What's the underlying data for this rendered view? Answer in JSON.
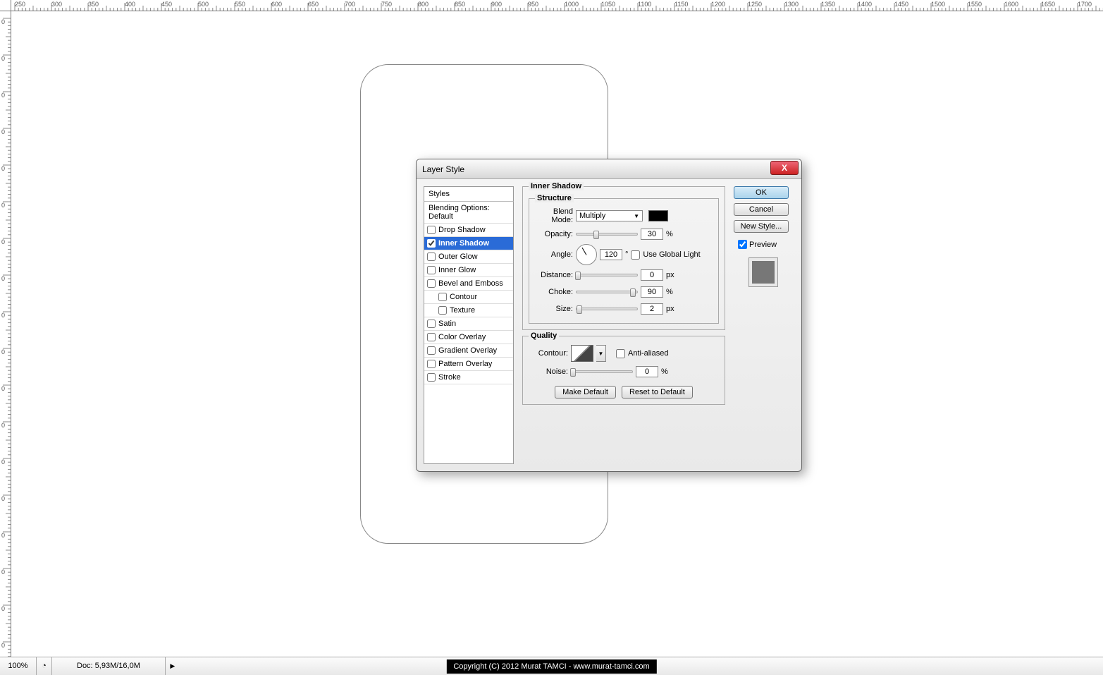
{
  "dialog": {
    "title": "Layer Style",
    "close_label": "X",
    "styles_header": "Styles",
    "styles": {
      "blending": "Blending Options: Default",
      "drop_shadow": "Drop Shadow",
      "inner_shadow": "Inner Shadow",
      "outer_glow": "Outer Glow",
      "inner_glow": "Inner Glow",
      "bevel_emboss": "Bevel and Emboss",
      "contour": "Contour",
      "texture": "Texture",
      "satin": "Satin",
      "color_overlay": "Color Overlay",
      "gradient_overlay": "Gradient Overlay",
      "pattern_overlay": "Pattern Overlay",
      "stroke": "Stroke"
    },
    "panel_title": "Inner Shadow",
    "structure_title": "Structure",
    "quality_title": "Quality",
    "labels": {
      "blend_mode": "Blend Mode:",
      "opacity": "Opacity:",
      "angle": "Angle:",
      "distance": "Distance:",
      "choke": "Choke:",
      "size": "Size:",
      "contour": "Contour:",
      "noise": "Noise:",
      "use_global": "Use Global Light",
      "anti_aliased": "Anti-aliased"
    },
    "values": {
      "blend_mode": "Multiply",
      "opacity": "30",
      "angle": "120",
      "distance": "0",
      "choke": "90",
      "size": "2",
      "noise": "0"
    },
    "units": {
      "percent": "%",
      "degree": "°",
      "px": "px"
    },
    "buttons": {
      "ok": "OK",
      "cancel": "Cancel",
      "new_style": "New Style...",
      "preview": "Preview",
      "make_default": "Make Default",
      "reset_default": "Reset to Default"
    }
  },
  "status": {
    "zoom": "100%",
    "doc": "Doc: 5,93M/16,0M",
    "play": "▶",
    "copyright": "Copyright (C) 2012 Murat TAMCI - www.murat-tamci.com"
  },
  "ruler_h": [
    "250",
    "300",
    "350",
    "400",
    "450",
    "500",
    "550",
    "600",
    "650",
    "700",
    "750",
    "800",
    "850",
    "900",
    "950",
    "1000",
    "1050",
    "1100",
    "1150",
    "1200",
    "1250",
    "1300",
    "1350",
    "1400",
    "1450",
    "1500",
    "1550",
    "1600",
    "1650",
    "1700"
  ],
  "ruler_v": [
    "0",
    "0",
    "0",
    "0",
    "0",
    "0",
    "0",
    "0",
    "0",
    "0",
    "0",
    "0",
    "0",
    "0",
    "0",
    "0",
    "0"
  ]
}
